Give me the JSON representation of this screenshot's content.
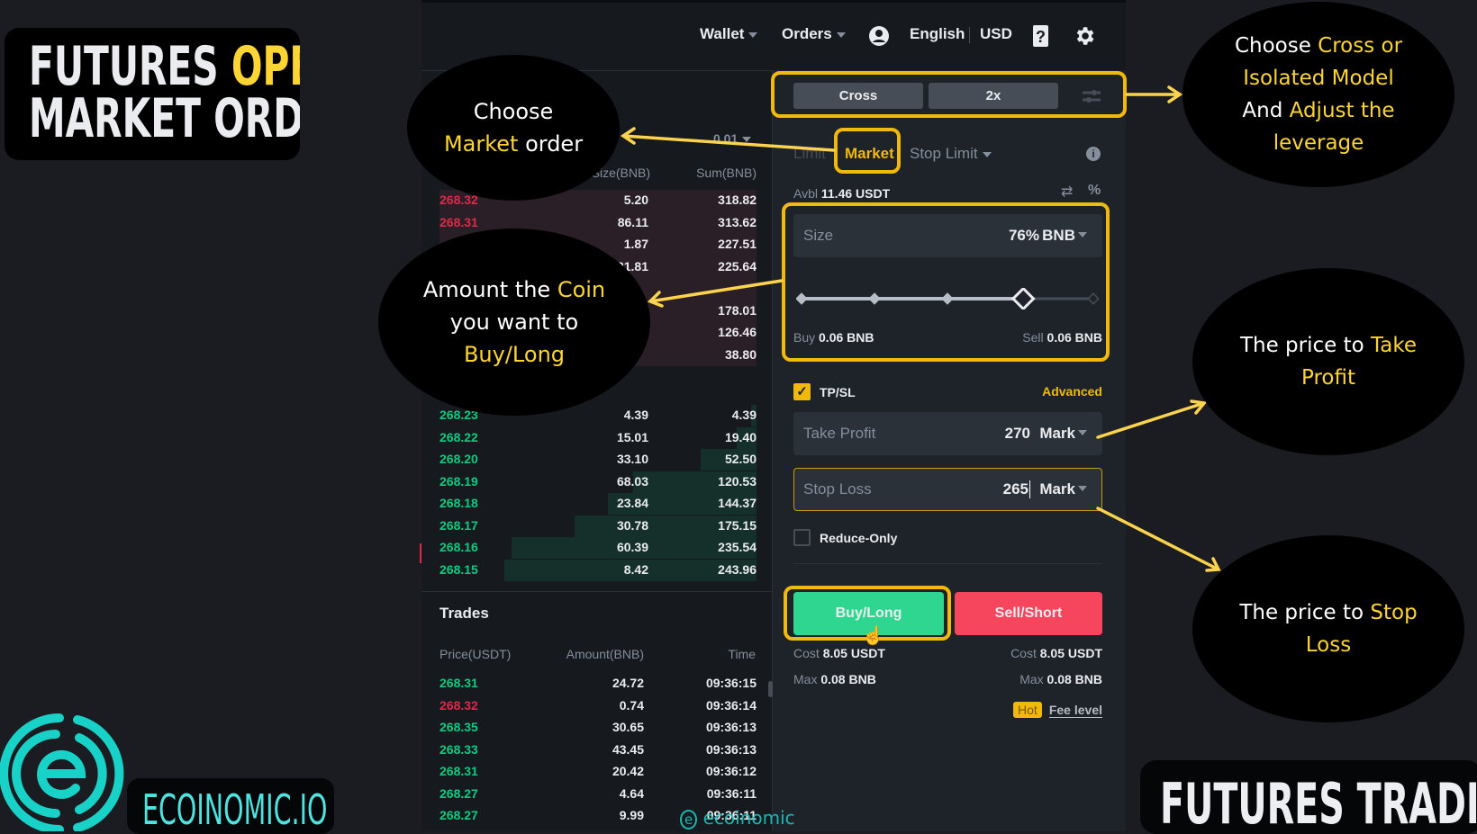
{
  "title": {
    "line1a": "FUTURES ",
    "line1b": "OPEN",
    "line2": "MARKET ORDER"
  },
  "header": {
    "wallet": "Wallet",
    "orders": "Orders",
    "language": "English",
    "currency": "USD",
    "icons": [
      "user-icon",
      "help-icon",
      "gear-icon"
    ]
  },
  "orderbook": {
    "precision": "0.01",
    "col_size": "Size(BNB)",
    "col_sum": "Sum(BNB)",
    "asks": [
      {
        "price": "268.32",
        "size": "5.20",
        "sum": "318.82"
      },
      {
        "price": "268.31",
        "size": "86.11",
        "sum": "313.62"
      },
      {
        "price": "",
        "size": "1.87",
        "sum": "227.51"
      },
      {
        "price": "",
        "size": "21.81",
        "sum": "225.64"
      },
      {
        "price": "",
        "size": "",
        "sum": ""
      },
      {
        "price": "",
        "size": "",
        "sum": "178.01"
      },
      {
        "price": "",
        "size": "",
        "sum": "126.46"
      },
      {
        "price": "",
        "size": "",
        "sum": "38.80"
      }
    ],
    "bids": [
      {
        "price": "268.23",
        "size": "4.39",
        "sum": "4.39",
        "depth": 0.02
      },
      {
        "price": "268.22",
        "size": "15.01",
        "sum": "19.40",
        "depth": 0.08
      },
      {
        "price": "268.20",
        "size": "33.10",
        "sum": "52.50",
        "depth": 0.22
      },
      {
        "price": "268.19",
        "size": "68.03",
        "sum": "120.53",
        "depth": 0.49
      },
      {
        "price": "268.18",
        "size": "23.84",
        "sum": "144.37",
        "depth": 0.59
      },
      {
        "price": "268.17",
        "size": "30.78",
        "sum": "175.15",
        "depth": 0.72
      },
      {
        "price": "268.16",
        "size": "60.39",
        "sum": "235.54",
        "depth": 0.97
      },
      {
        "price": "268.15",
        "size": "8.42",
        "sum": "243.96",
        "depth": 1.0
      }
    ]
  },
  "trades": {
    "title": "Trades",
    "col_price": "Price(USDT)",
    "col_amount": "Amount(BNB)",
    "col_time": "Time",
    "rows": [
      {
        "price": "268.31",
        "amount": "24.72",
        "time": "09:36:15",
        "side": "buy"
      },
      {
        "price": "268.32",
        "amount": "0.74",
        "time": "09:36:14",
        "side": "sell"
      },
      {
        "price": "268.35",
        "amount": "30.65",
        "time": "09:36:13",
        "side": "buy"
      },
      {
        "price": "268.33",
        "amount": "43.45",
        "time": "09:36:13",
        "side": "buy"
      },
      {
        "price": "268.31",
        "amount": "20.42",
        "time": "09:36:12",
        "side": "buy"
      },
      {
        "price": "268.27",
        "amount": "4.64",
        "time": "09:36:11",
        "side": "buy"
      },
      {
        "price": "268.27",
        "amount": "9.99",
        "time": "09:36:11",
        "side": "buy"
      }
    ]
  },
  "form": {
    "margin_mode": "Cross",
    "leverage": "2x",
    "tabs": {
      "limit": "Limit",
      "market": "Market",
      "stop_limit": "Stop Limit"
    },
    "avbl_label": "Avbl",
    "avbl_value": "11.46 USDT",
    "size_label": "Size",
    "size_pct": "76%",
    "size_unit": "BNB",
    "slider_percent": 76,
    "buy_label": "Buy",
    "buy_value": "0.06 BNB",
    "sell_label": "Sell",
    "sell_value": "0.06 BNB",
    "tpsl_label": "TP/SL",
    "tpsl_checked": true,
    "advanced": "Advanced",
    "take_profit_label": "Take Profit",
    "take_profit_value": "270",
    "tp_trigger": "Mark",
    "stop_loss_label": "Stop Loss",
    "stop_loss_value": "265",
    "sl_trigger": "Mark",
    "reduce_only": "Reduce-Only",
    "reduce_only_checked": false,
    "buy_button": "Buy/Long",
    "sell_button": "Sell/Short",
    "cost_label": "Cost",
    "buy_cost": "8.05 USDT",
    "sell_cost": "8.05 USDT",
    "max_label": "Max",
    "buy_max": "0.08 BNB",
    "sell_max": "0.08 BNB",
    "hot": "Hot",
    "fee_level": "Fee level"
  },
  "callouts": {
    "market": {
      "a": "Choose",
      "b": "Market",
      "c": " order"
    },
    "amount": {
      "a": "Amount the ",
      "b": "Coin",
      "c": "you want to",
      "d": "Buy/Long"
    },
    "cross": {
      "a": "Choose ",
      "b": "Cross or",
      "c": "Isolated Model",
      "d": "And ",
      "e": "Adjust the",
      "f": "leverage"
    },
    "tp": {
      "a": "The price to ",
      "b": "Take",
      "c": "Profit"
    },
    "sl": {
      "a": "The price to ",
      "b": "Stop",
      "c": "Loss"
    }
  },
  "brand": {
    "name": "ECOINOMIC.IO",
    "watermark": "ecoinomic",
    "footer": "FUTURES TRADING"
  },
  "colors": {
    "accent": "#f0b90b",
    "buy": "#2ed68f",
    "sell": "#f6465d",
    "brand": "#18d2c8"
  }
}
